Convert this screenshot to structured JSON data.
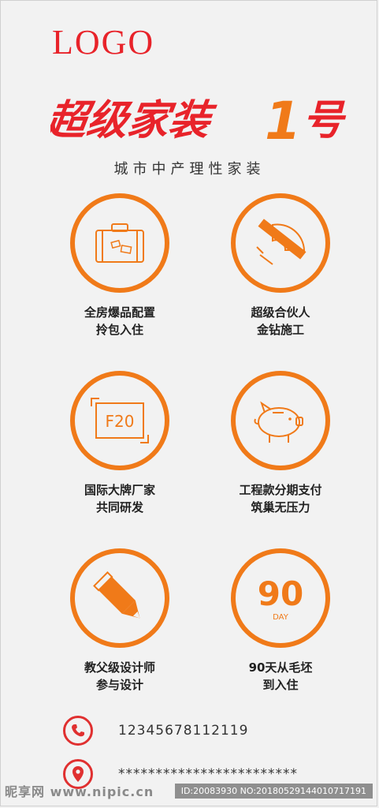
{
  "header": {
    "logo": "LOGO",
    "brand_title": "超级家装",
    "brand_number": "1",
    "brand_suffix": "号",
    "subtitle": "城市中产理性家装"
  },
  "features": [
    {
      "line1": "全房爆品配置",
      "line2": "拎包入住",
      "icon": "suitcase-icon"
    },
    {
      "line1": "超级合伙人",
      "line2": "金钻施工",
      "icon": "ruler-tools-icon"
    },
    {
      "line1": "国际大牌厂家",
      "line2": "共同研发",
      "icon": "f20-icon",
      "icon_text": "F20"
    },
    {
      "line1": "工程款分期支付",
      "line2": "筑巢无压力",
      "icon": "piggy-bank-icon"
    },
    {
      "line1": "教父级设计师",
      "line2": "参与设计",
      "icon": "pencil-icon"
    },
    {
      "line1": "90天从毛坯",
      "line2": "到入住",
      "icon": "90-day-icon",
      "icon_text": "90",
      "icon_subtext": "DAY"
    }
  ],
  "contact": {
    "phone": "12345678112119",
    "address": "************************"
  },
  "watermark": {
    "left": "昵享网 www.nipic.cn",
    "right": "ID:20083930 NO:20180529144010717191"
  },
  "colors": {
    "accent": "#f07a19",
    "brand_red": "#e8232a",
    "background": "#f2f2f2"
  }
}
